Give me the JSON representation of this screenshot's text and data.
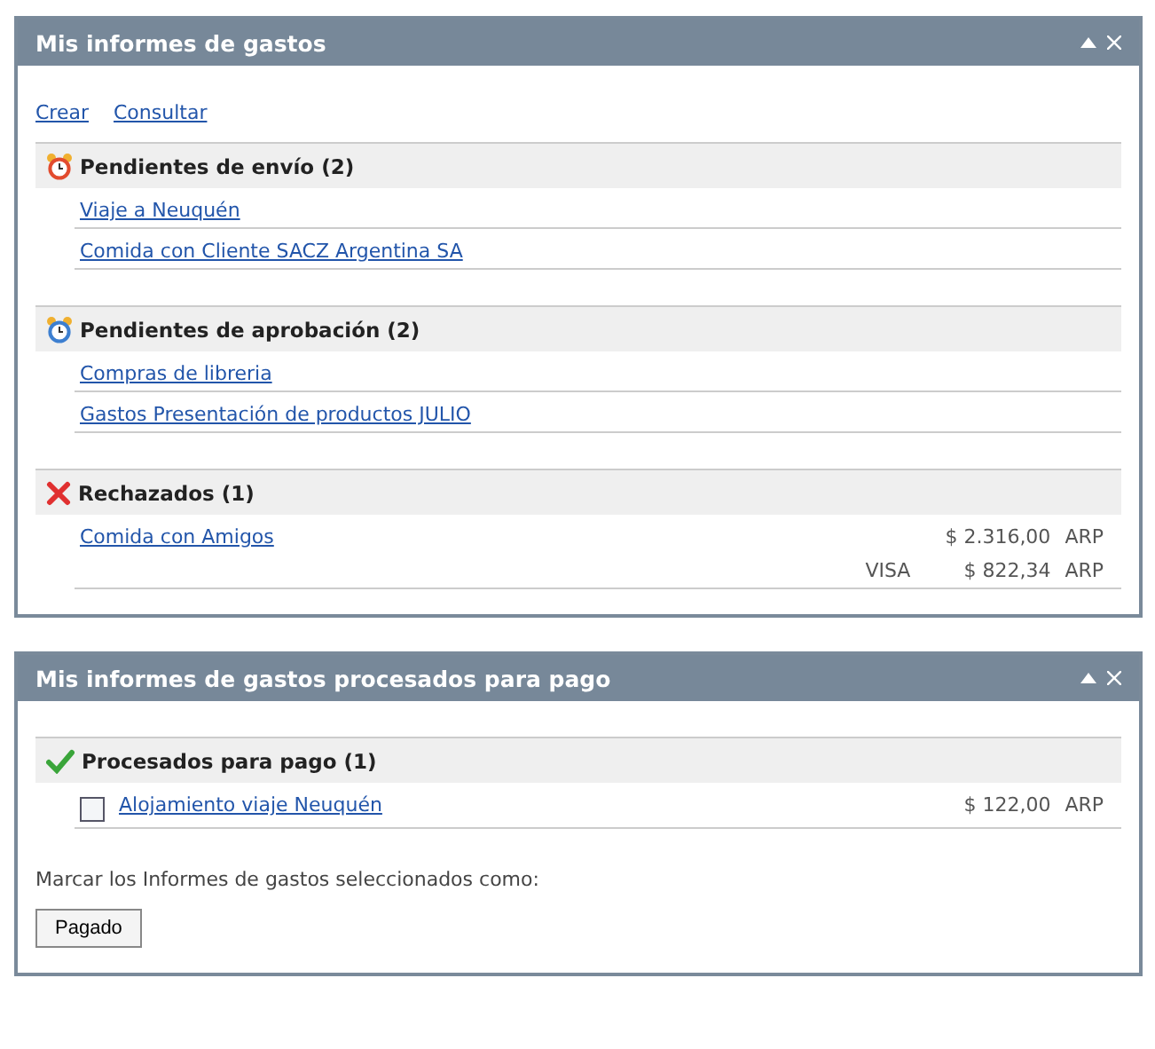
{
  "panels": [
    {
      "title": "Mis informes de gastos",
      "actions": [
        "Crear",
        "Consultar"
      ],
      "sections": [
        {
          "kind": "pending-send",
          "title": "Pendientes de envío (2)",
          "items": [
            {
              "label": "Viaje a Neuquén"
            },
            {
              "label": "Comida con Cliente SACZ Argentina SA"
            }
          ]
        },
        {
          "kind": "pending-approval",
          "title": "Pendientes de aprobación (2)",
          "items": [
            {
              "label": "Compras de libreria"
            },
            {
              "label": "Gastos Presentación de productos JULIO"
            }
          ]
        },
        {
          "kind": "rejected",
          "title": "Rechazados (1)",
          "items": [
            {
              "label": "Comida con Amigos",
              "amounts": [
                {
                  "amount": "$ 2.316,00",
                  "currency": "ARP"
                },
                {
                  "method": "VISA",
                  "amount": "$ 822,34",
                  "currency": "ARP"
                }
              ]
            }
          ]
        }
      ]
    },
    {
      "title": "Mis informes de gastos procesados para pago",
      "sections": [
        {
          "kind": "processed",
          "title": "Procesados para pago (1)",
          "items": [
            {
              "label": "Alojamiento viaje Neuquén",
              "checked": false,
              "amounts": [
                {
                  "amount": "$ 122,00",
                  "currency": "ARP"
                }
              ]
            }
          ]
        }
      ],
      "footer": {
        "text": "Marcar los Informes de gastos seleccionados como:",
        "button": "Pagado"
      }
    }
  ]
}
